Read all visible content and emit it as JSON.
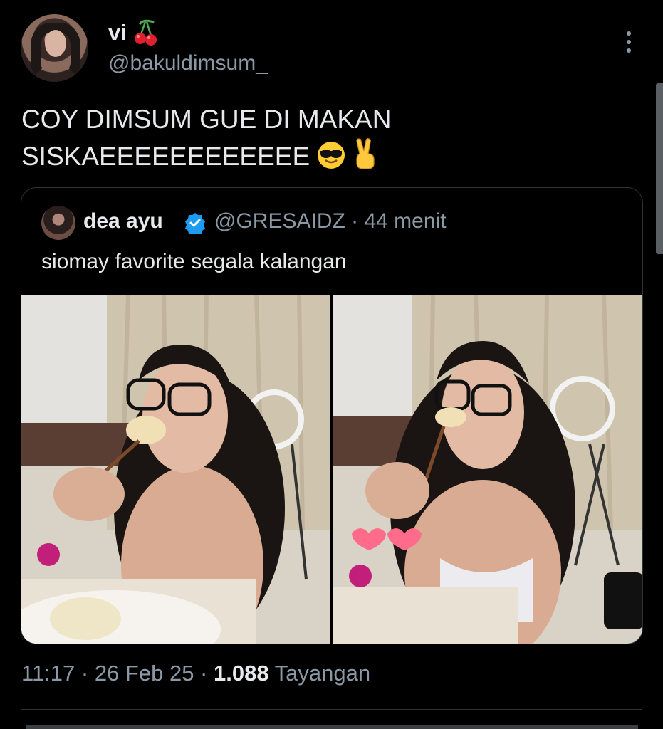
{
  "author": {
    "display_name": "vi",
    "name_emoji": "cherries-emoji",
    "handle": "@bakuldimsum_"
  },
  "tweet": {
    "line1": "COY DIMSUM GUE DI MAKAN",
    "line2": "SISKAEEEEEEEEEEEE",
    "emojis": [
      "sunglasses-emoji",
      "victory-hand-emoji"
    ]
  },
  "quoted": {
    "display_name": "dea ayu",
    "verified_icon": "verified-badge-icon",
    "meta": "@GRESAIDZ · 44 menit",
    "text": "siomay favorite segala kalangan",
    "media_count": 2
  },
  "footer": {
    "time_date": "11:17 · 26 Feb 25 · ",
    "views_count": "1.088",
    "views_label": " Tayangan"
  },
  "colors": {
    "background": "#000000",
    "text_primary": "#e7e9ea",
    "text_secondary": "#8b98a5",
    "border": "#2f3336",
    "verified_blue": "#1d9bf0"
  }
}
